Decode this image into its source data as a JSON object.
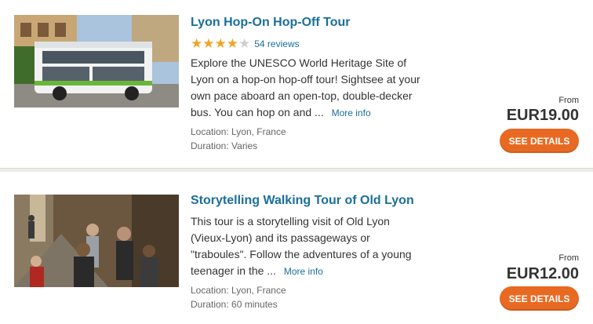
{
  "colors": {
    "accent": "#e86a22",
    "link": "#1a6f99",
    "star": "#f0a528"
  },
  "tours": [
    {
      "title": "Lyon Hop-On Hop-Off Tour",
      "rating": 4.5,
      "reviews": "54 reviews",
      "description": "Explore the UNESCO World Heritage Site of Lyon on a hop-on hop-off tour! Sightsee at your own pace aboard an open-top, double-decker bus. You can hop on and ...",
      "more_info": "More info",
      "location": "Location: Lyon, France",
      "duration": "Duration: Varies",
      "from": "From",
      "price": "EUR19.00",
      "button": "SEE DETAILS",
      "image": "double-decker-bus-photo"
    },
    {
      "title": "Storytelling Walking Tour of Old Lyon",
      "description": "This tour is a storytelling visit of Old Lyon (Vieux-Lyon) and its passageways or \"traboules\". Follow the adventures of a young teenager in the ...",
      "more_info": "More info",
      "location": "Location: Lyon, France",
      "duration": "Duration: 60 minutes",
      "from": "From",
      "price": "EUR12.00",
      "button": "SEE DETAILS",
      "image": "walking-tour-crowd-photo"
    }
  ]
}
